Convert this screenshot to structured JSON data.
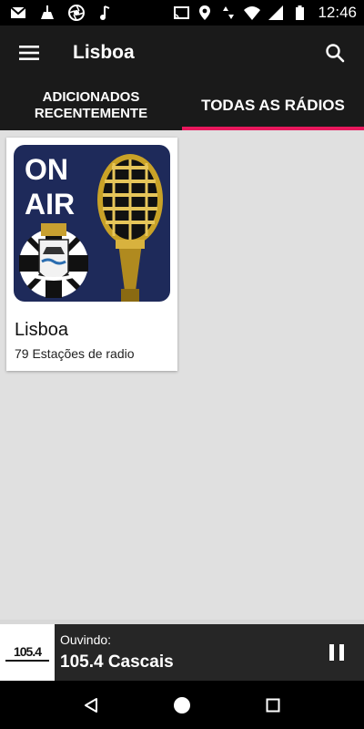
{
  "status_bar": {
    "time": "12:46",
    "left_icons": [
      "gmail-icon",
      "cleaner-icon",
      "camera-aperture-icon",
      "music-note-icon"
    ],
    "right_icons": [
      "cast-icon",
      "location-icon",
      "data-arrows-icon",
      "wifi-icon",
      "signal-icon",
      "battery-icon"
    ]
  },
  "app_bar": {
    "title": "Lisboa",
    "menu_icon": "menu-icon",
    "search_icon": "search-icon"
  },
  "tabs": [
    {
      "label": "ADICIONADOS RECENTEMENTE",
      "active": false
    },
    {
      "label": "TODAS AS RÁDIOS",
      "active": true
    }
  ],
  "colors": {
    "accent": "#e8185d",
    "app_bar_bg": "#1a1a1a",
    "content_bg": "#e0e0e0",
    "player_bg": "#262626",
    "art_bg": "#1e2a5a"
  },
  "card": {
    "art_text": [
      "ON",
      "AIR"
    ],
    "title": "Lisboa",
    "subtitle": "79 Estações de radio"
  },
  "player": {
    "logo_text": "105.4",
    "label": "Ouvindo:",
    "station": "105.4 Cascais",
    "control_icon": "pause-icon"
  },
  "nav_bar": {
    "buttons": [
      "back-icon",
      "home-icon",
      "recents-icon"
    ]
  }
}
